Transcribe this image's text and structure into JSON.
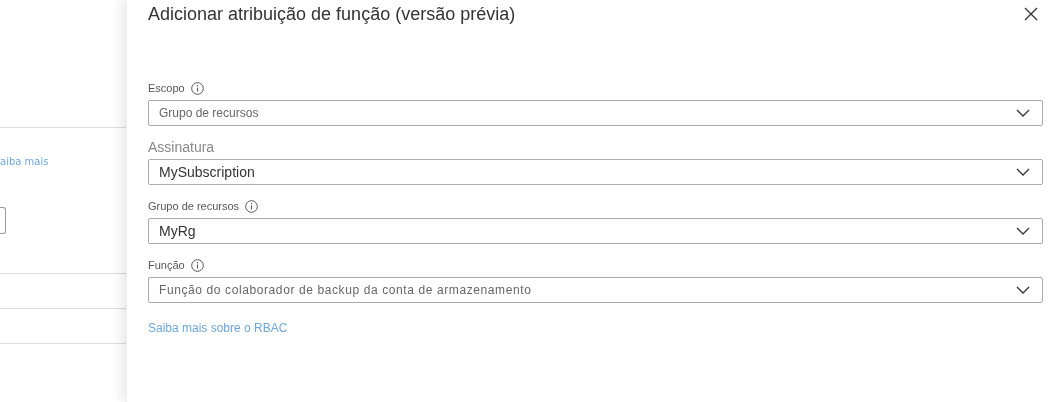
{
  "background": {
    "link": "aiba mais"
  },
  "panel": {
    "title": "Adicionar atribuição de função (versão prévia)",
    "fields": [
      {
        "kind": "muted",
        "label": "Escopo",
        "info": true,
        "value": "Grupo de recursos"
      },
      {
        "kind": "heading",
        "label": "Assinatura",
        "info": false,
        "value": "MySubscription"
      },
      {
        "kind": "strong",
        "label": "Grupo de recursos",
        "info": true,
        "value": "MyRg"
      },
      {
        "kind": "spaced",
        "label": "Função",
        "info": true,
        "value": "Função do colaborador de backup da conta de armazenamento"
      }
    ],
    "link": "Saiba mais sobre o RBAC"
  }
}
